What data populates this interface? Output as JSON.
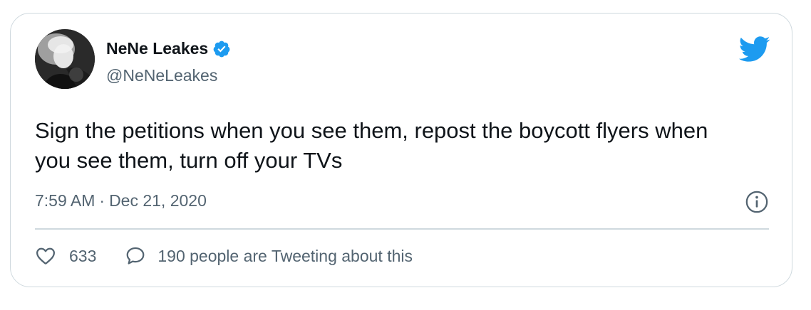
{
  "tweet": {
    "author": {
      "name": "NeNe Leakes",
      "handle": "@NeNeLeakes",
      "verified": true,
      "verified_color": "#1d9bf0"
    },
    "text": "Sign the petitions when you see them, repost the boycott flyers when you see them, turn off your TVs",
    "time": "7:59 AM",
    "separator": "·",
    "date": "Dec 21, 2020",
    "likes": "633",
    "tweeting_text": "190 people are Tweeting about this",
    "icons": {
      "brand": "twitter-bird-icon",
      "info": "info-icon",
      "like": "heart-icon",
      "reply": "speech-bubble-icon"
    },
    "colors": {
      "brand": "#1d9bf0",
      "text": "#0f1419",
      "secondary": "#536471",
      "border": "#cfd9de"
    }
  }
}
